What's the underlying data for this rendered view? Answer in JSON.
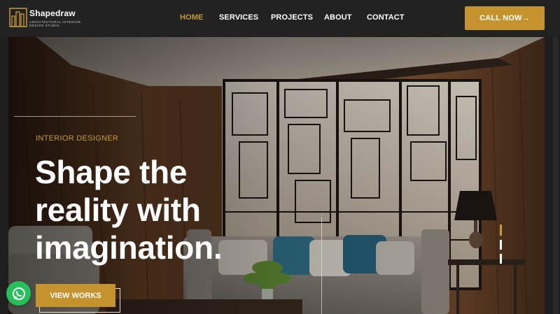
{
  "brand": {
    "name": "Shapedraw",
    "tagline": "Architectural Interior Design Studio"
  },
  "nav": {
    "items": [
      {
        "label": "HOME",
        "active": true
      },
      {
        "label": "SERVICES",
        "active": false
      },
      {
        "label": "PROJECTS",
        "active": false
      },
      {
        "label": "ABOUT",
        "active": false
      },
      {
        "label": "CONTACT",
        "active": false
      }
    ],
    "cta_label": "CALL NOW→"
  },
  "hero": {
    "eyebrow": "INTERIOR DESIGNER",
    "headline_lines": [
      "Shape the",
      "reality with",
      "imagination."
    ],
    "button_label": "VIEW WORKS"
  },
  "colors": {
    "accent": "#c4932e",
    "header_bg": "#222222",
    "whatsapp": "#25c05a"
  },
  "icons": {
    "whatsapp": "whatsapp-icon",
    "logo": "building-logo-icon"
  }
}
